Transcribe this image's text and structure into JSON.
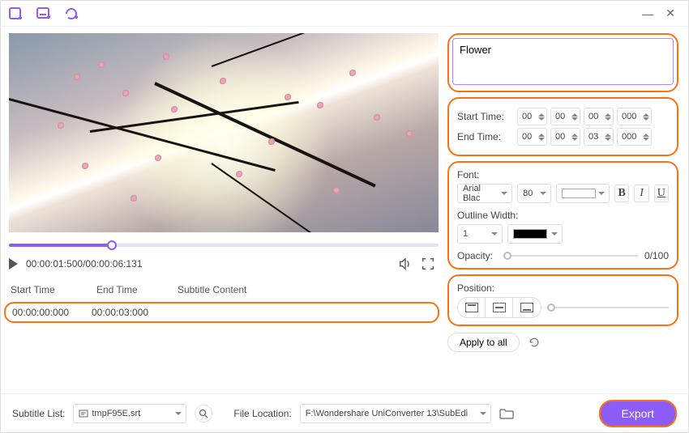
{
  "titlebar": {
    "minimize": "—",
    "close": "✕"
  },
  "preview": {
    "time_display": "00:00:01:500/00:00:06:131"
  },
  "table": {
    "headers": {
      "start": "Start Time",
      "end": "End Time",
      "content": "Subtitle Content"
    },
    "rows": [
      {
        "start": "00:00:00:000",
        "end": "00:00:03:000"
      }
    ]
  },
  "subtitle": {
    "text": "Flower"
  },
  "times": {
    "start_label": "Start Time:",
    "end_label": "End Time:",
    "start": {
      "h": "00",
      "m": "00",
      "s": "00",
      "ms": "000"
    },
    "end": {
      "h": "00",
      "m": "00",
      "s": "03",
      "ms": "000"
    }
  },
  "font": {
    "label": "Font:",
    "family": "Arial Blac",
    "size": "80",
    "color": "#ffffff",
    "outline_label": "Outline Width:",
    "outline_width": "1",
    "outline_color": "#000000",
    "opacity_label": "Opacity:",
    "opacity_value": "0/100"
  },
  "position": {
    "label": "Position:"
  },
  "apply": {
    "label": "Apply to all"
  },
  "footer": {
    "list_label": "Subtitle List:",
    "list_file": "tmpF95E.srt",
    "location_label": "File Location:",
    "location_path": "F:\\Wondershare UniConverter 13\\SubEdi",
    "export": "Export"
  }
}
